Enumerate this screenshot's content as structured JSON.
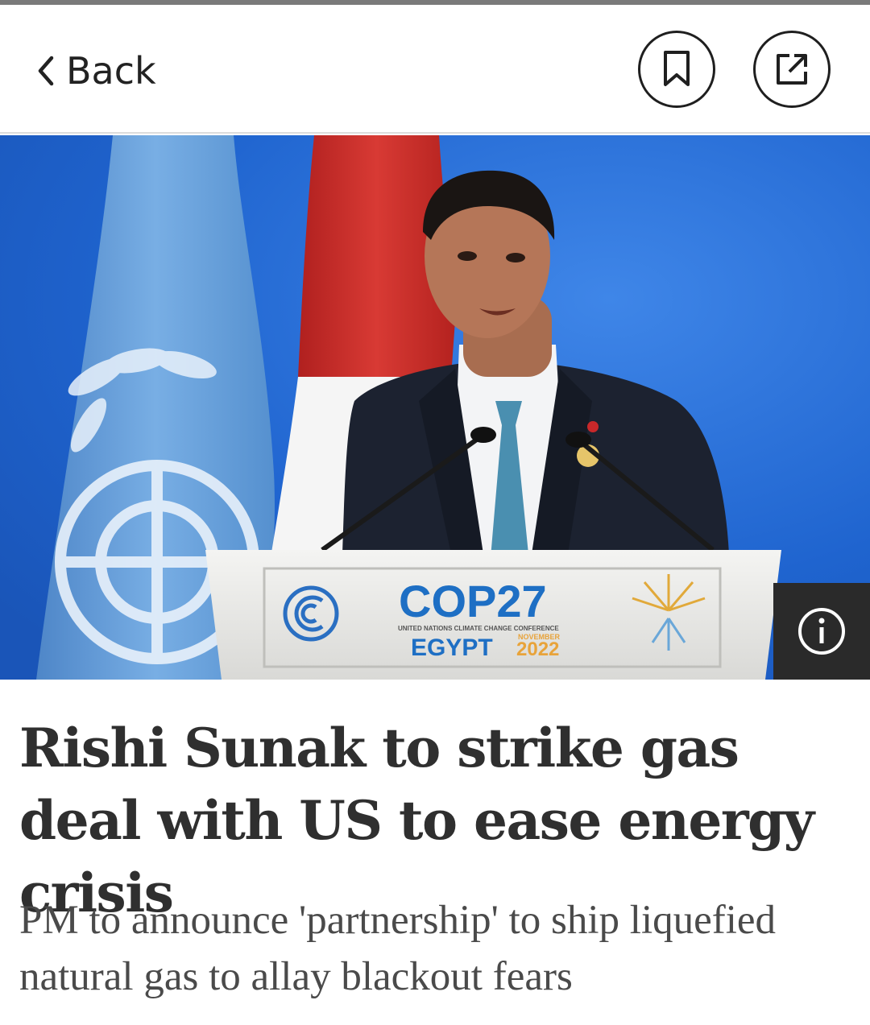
{
  "nav": {
    "back_label": "Back"
  },
  "hero": {
    "podium_brand": "COP27",
    "podium_subtitle": "UNITED NATIONS CLIMATE CHANGE CONFERENCE",
    "podium_country": "EGYPT",
    "podium_month": "NOVEMBER",
    "podium_year": "2022"
  },
  "article": {
    "headline": "Rishi Sunak to strike gas deal with US to ease energy crisis",
    "standfirst": "PM to announce 'partnership' to ship liquefied natural gas to allay blackout fears"
  },
  "icons": {
    "back": "chevron-left-icon",
    "bookmark": "bookmark-icon",
    "share": "share-icon",
    "info": "info-icon"
  },
  "colors": {
    "accent": "#1f1f1f",
    "background_blue": "#1f6ad6",
    "un_blue": "#5f98d6",
    "flag_red": "#c8282a",
    "cop_blue": "#1e6fc4",
    "cop_orange": "#e8a33a"
  }
}
